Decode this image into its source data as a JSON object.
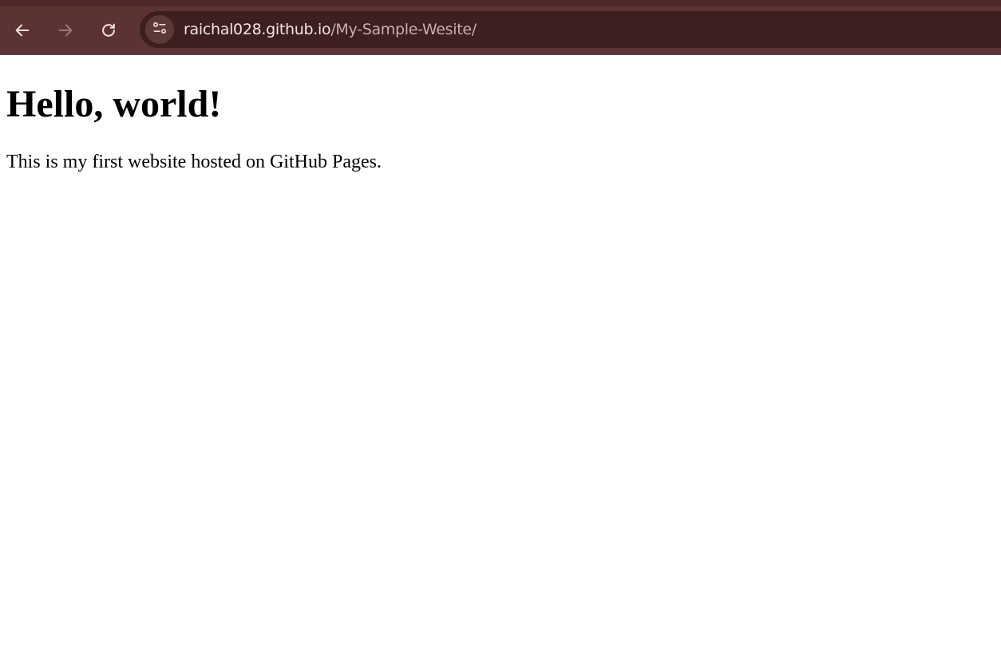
{
  "browser": {
    "url_host": "raichal028.github.io",
    "url_path": "/My-Sample-Wesite/",
    "icons": {
      "back": "arrow-left-icon",
      "forward": "arrow-right-icon",
      "reload": "reload-icon",
      "site_info": "tune-icon"
    },
    "colors": {
      "toolbar": "#5a3332",
      "omnibox": "#3c1f1e",
      "url_host": "#f4e4e3",
      "url_path": "#c9aeac"
    }
  },
  "page": {
    "heading": "Hello, world!",
    "paragraph": "This is my first website hosted on GitHub Pages."
  }
}
